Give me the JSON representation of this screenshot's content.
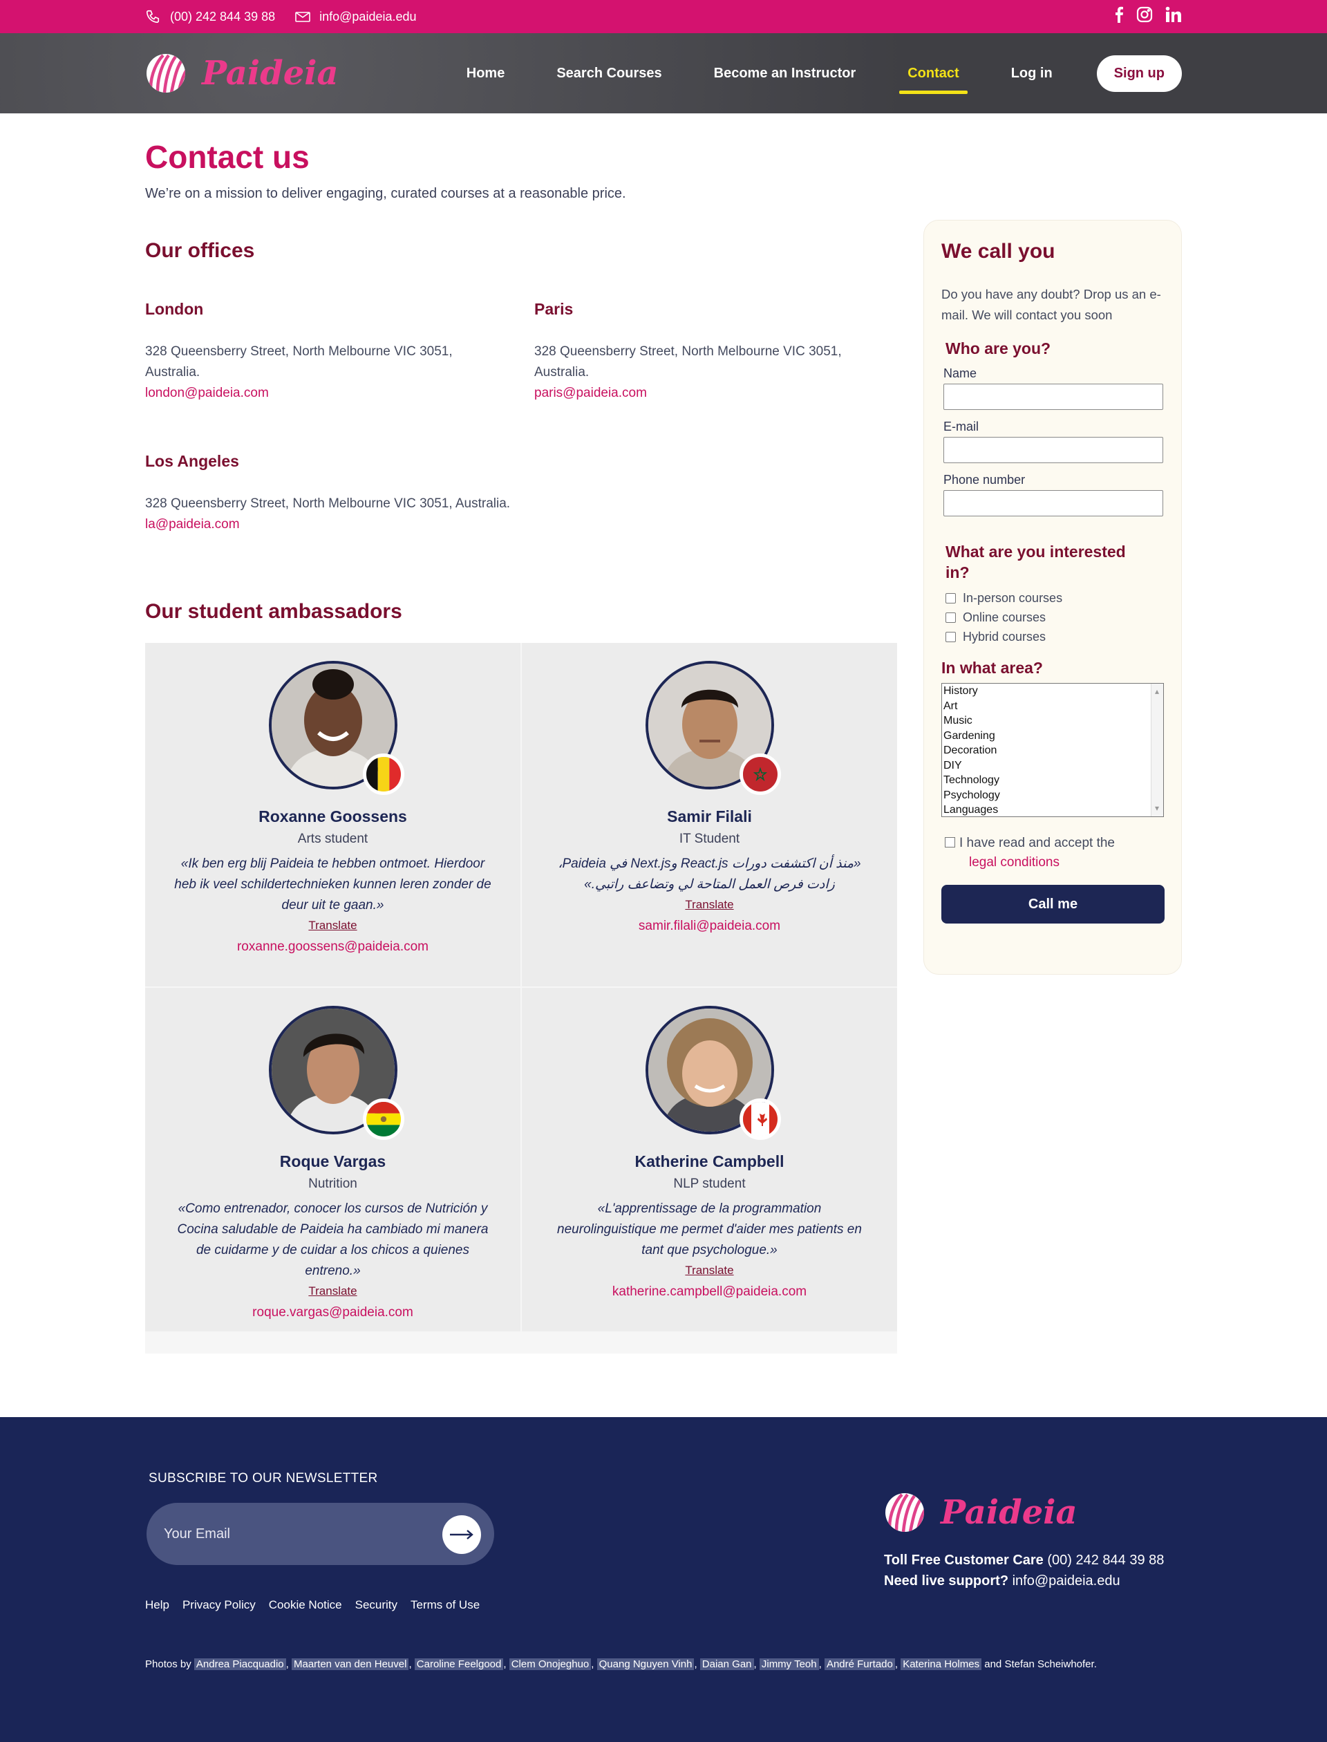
{
  "topbar": {
    "phone": "(00) 242 844 39 88",
    "email": "info@paideia.edu",
    "social": [
      "f",
      "ig",
      "in"
    ],
    "bg_color": "#d4126f"
  },
  "header": {
    "brand": "Paideia",
    "nav": [
      {
        "label": "Home",
        "active": false
      },
      {
        "label": "Search Courses",
        "active": false
      },
      {
        "label": "Become an Instructor",
        "active": false
      },
      {
        "label": "Contact",
        "active": true
      },
      {
        "label": "Log in",
        "active": false
      }
    ],
    "signup": "Sign up",
    "active_color": "#f3e217"
  },
  "page": {
    "title": "Contact us",
    "lead": "We’re on a mission to deliver engaging, curated courses at a reasonable price."
  },
  "offices": {
    "heading": "Our offices",
    "list": [
      {
        "city": "London",
        "address": "328 Queensberry Street, North Melbourne VIC 3051, Australia.",
        "email": "london@paideia.com"
      },
      {
        "city": "Paris",
        "address": "328 Queensberry Street, North Melbourne VIC 3051, Australia.",
        "email": "paris@paideia.com"
      },
      {
        "city": "Los Angeles",
        "address": "328 Queensberry Street, North Melbourne VIC 3051, Australia.",
        "email": "la@paideia.com"
      }
    ]
  },
  "ambassadors": {
    "heading": "Our student ambassadors",
    "translate": "Translate",
    "list": [
      {
        "name": "Roxanne Goossens",
        "role": "Arts student",
        "quote": "«Ik ben erg blij Paideia te hebben ontmoet. Hierdoor heb ik veel schildertechnieken kunnen leren zonder de deur uit te gaan.»",
        "email": "roxanne.goossens@paideia.com",
        "flag": "belgium-flag"
      },
      {
        "name": "Samir Filali",
        "role": "IT Student",
        "quote": "«منذ أن اكتشفت دورات React.js وNext.js في Paideia، زادت فرص العمل المتاحة لي وتضاعف راتبي.»",
        "email": "samir.filali@paideia.com",
        "flag": "morocco-flag"
      },
      {
        "name": "Roque Vargas",
        "role": "Nutrition",
        "quote": "«Como entrenador, conocer los cursos de Nutrición y Cocina saludable de Paideia ha cambiado mi manera de cuidarme y de cuidar a los chicos a quienes entreno.»",
        "email": "roque.vargas@paideia.com",
        "flag": "bolivia-flag"
      },
      {
        "name": "Katherine Campbell",
        "role": "NLP student",
        "quote": "«L'apprentissage de la programmation neurolinguistique me permet d'aider mes patients en tant que psychologue.»",
        "email": "katherine.campbell@paideia.com",
        "flag": "canada-flag"
      }
    ]
  },
  "form": {
    "heading": "We call you",
    "description": "Do you have any doubt? Drop us an e-mail. We will contact you soon",
    "who_heading": "Who are you?",
    "name_label": "Name",
    "email_label": "E-mail",
    "phone_label": "Phone number",
    "interest_heading": "What are you interested in?",
    "interests": [
      "In-person courses",
      "Online courses",
      "Hybrid courses"
    ],
    "area_heading": "In what area?",
    "areas": [
      "History",
      "Art",
      "Music",
      "Gardening",
      "Decoration",
      "DIY",
      "Technology",
      "Psychology",
      "Languages"
    ],
    "accept_text": "I have read and accept the",
    "legal_link": "legal conditions",
    "submit": "Call me"
  },
  "footer": {
    "newsletter": "SUBSCRIBE TO OUR NEWSLETTER",
    "email_placeholder": "Your Email",
    "links": [
      "Help",
      "Privacy Policy",
      "Cookie Notice",
      "Security",
      "Terms of Use"
    ],
    "photos_prefix": "Photos by",
    "photographers": [
      "Andrea Piacquadio",
      "Maarten van den Heuvel",
      "Caroline Feelgood",
      "Clem Onojeghuo",
      "Quang Nguyen Vinh",
      "Daian Gan",
      "Jimmy Teoh",
      "André Furtado",
      "Katerina Holmes"
    ],
    "photos_suffix": "and Stefan Scheiwhofer.",
    "brand": "Paideia",
    "tollfree_label": "Toll Free Customer Care",
    "tollfree_value": "(00) 242 844 39 88",
    "support_label": "Need live support?",
    "support_value": "info@paideia.edu",
    "bg_color": "#1a2557"
  }
}
